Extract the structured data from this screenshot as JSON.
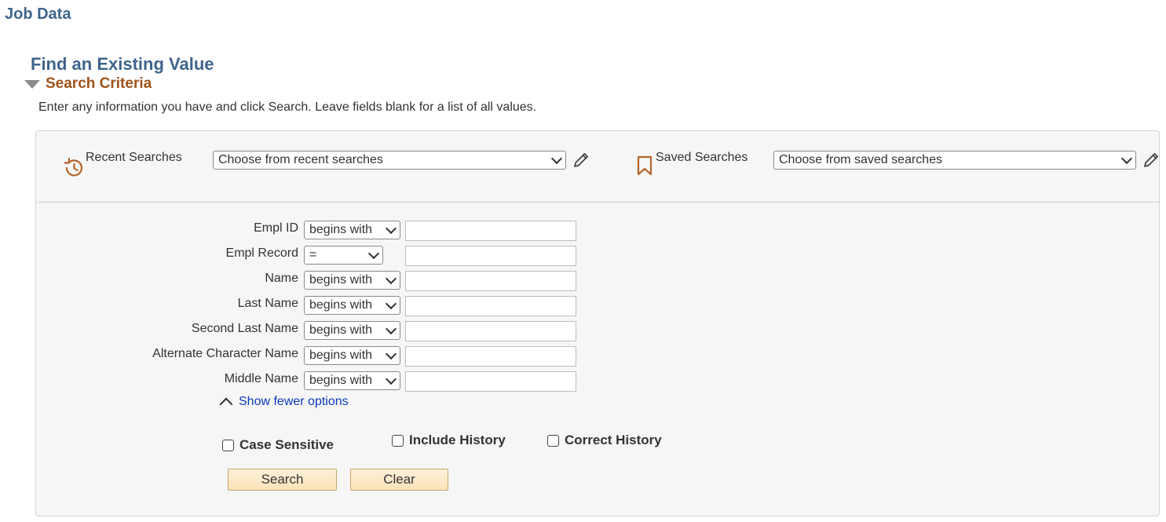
{
  "page": {
    "title": "Job Data"
  },
  "search": {
    "heading": "Find an Existing Value",
    "criteria_label": "Search Criteria",
    "instructions": "Enter any information you have and click Search. Leave fields blank for a list of all values."
  },
  "recent": {
    "label": "Recent Searches",
    "placeholder": "Choose from recent searches"
  },
  "saved": {
    "label": "Saved Searches",
    "placeholder": "Choose from saved searches"
  },
  "fields": [
    {
      "label": "Empl ID",
      "operator": "begins with",
      "value": ""
    },
    {
      "label": "Empl Record",
      "operator": "=",
      "value": ""
    },
    {
      "label": "Name",
      "operator": "begins with",
      "value": ""
    },
    {
      "label": "Last Name",
      "operator": "begins with",
      "value": ""
    },
    {
      "label": "Second Last Name",
      "operator": "begins with",
      "value": ""
    },
    {
      "label": "Alternate Character Name",
      "operator": "begins with",
      "value": ""
    },
    {
      "label": "Middle Name",
      "operator": "begins with",
      "value": ""
    }
  ],
  "options_link": "Show fewer options",
  "checkboxes": {
    "case_sensitive": {
      "label": "Case Sensitive",
      "checked": false
    },
    "include_history": {
      "label": "Include History",
      "checked": false
    },
    "correct_history": {
      "label": "Correct History",
      "checked": false
    }
  },
  "buttons": {
    "search": "Search",
    "clear": "Clear"
  },
  "colors": {
    "title_blue": "#3f648c",
    "criteria_orange": "#a0521b",
    "link_blue": "#0a3ab8",
    "button_fill": "#fae3b8"
  },
  "icons": {
    "recent": "history-icon",
    "saved": "bookmark-icon",
    "edit": "pencil-icon",
    "collapse": "triangle-down-icon",
    "fewer": "chevron-up-icon"
  }
}
